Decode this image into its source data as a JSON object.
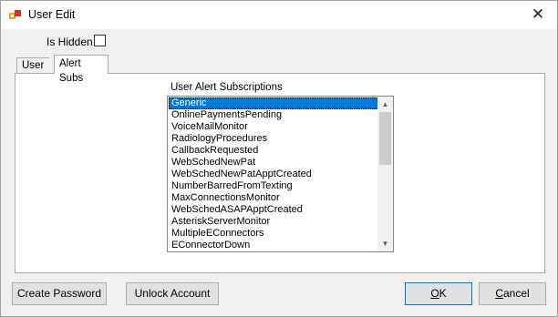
{
  "window": {
    "title": "User Edit",
    "close_glyph": "✕"
  },
  "hidden": {
    "label": "Is Hidden",
    "checked": false
  },
  "tabs": [
    {
      "label": "User",
      "active": false
    },
    {
      "label": "Alert Subs",
      "active": true
    }
  ],
  "alert_subs": {
    "title": "User Alert Subscriptions",
    "items": [
      "Generic",
      "OnlinePaymentsPending",
      "VoiceMailMonitor",
      "RadiologyProcedures",
      "CallbackRequested",
      "WebSchedNewPat",
      "WebSchedNewPatApptCreated",
      "NumberBarredFromTexting",
      "MaxConnectionsMonitor",
      "WebSchedASAPApptCreated",
      "AsteriskServerMonitor",
      "MultipleEConnectors",
      "EConnectorDown"
    ],
    "selected_index": 0
  },
  "buttons": {
    "create_password": "Create Password",
    "unlock_account": "Unlock Account",
    "ok_mnemonic": "O",
    "ok_rest": "K",
    "cancel_mnemonic": "C",
    "cancel_rest": "ancel"
  },
  "icons": {
    "app": "app-icon",
    "scroll_up": "chevron-up-icon",
    "scroll_down": "chevron-down-icon"
  },
  "colors": {
    "selection": "#0078d7",
    "ok_border": "#0078d7"
  }
}
